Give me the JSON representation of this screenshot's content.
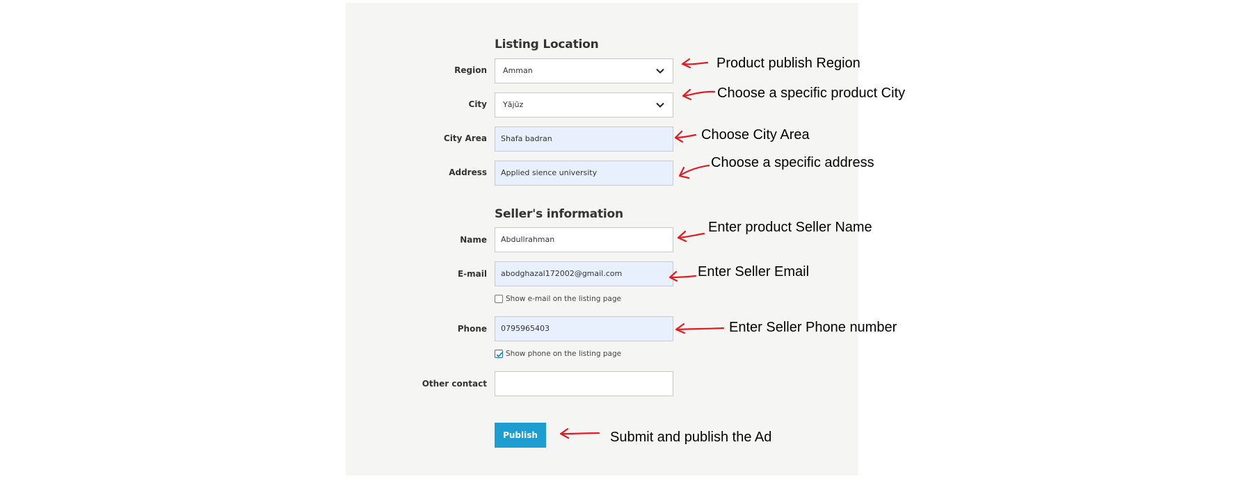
{
  "location": {
    "title": "Listing Location",
    "region": {
      "label": "Region",
      "value": "Amman"
    },
    "city": {
      "label": "City",
      "value": "Yājūz"
    },
    "city_area": {
      "label": "City Area",
      "value": "Shafa badran"
    },
    "address": {
      "label": "Address",
      "value": "Applied sience university"
    }
  },
  "seller": {
    "title": "Seller's information",
    "name": {
      "label": "Name",
      "value": "Abdullrahman"
    },
    "email": {
      "label": "E-mail",
      "value": "abodghazal172002@gmail.com",
      "show_label": "Show e-mail on the listing page",
      "show_checked": false
    },
    "phone": {
      "label": "Phone",
      "value": "0795965403",
      "show_label": "Show phone on the listing page",
      "show_checked": true
    },
    "other": {
      "label": "Other contact",
      "value": ""
    }
  },
  "publish_label": "Publish",
  "annotations": {
    "region": "Product publish Region",
    "city": "Choose a specific product City",
    "city_area": "Choose City Area",
    "address": "Choose a specific address",
    "name": "Enter product Seller Name",
    "email": "Enter Seller Email",
    "phone": "Enter Seller Phone number",
    "publish": "Submit and publish the Ad"
  },
  "colors": {
    "panel_bg": "#f5f5f4",
    "autofill_bg": "#e8f0fe",
    "publish_bg": "#1e9ed0",
    "annotation_arrow": "#e31b23"
  },
  "icons": {
    "select_chevron": "chevron-down-icon",
    "checkbox_checked": "check-icon"
  }
}
